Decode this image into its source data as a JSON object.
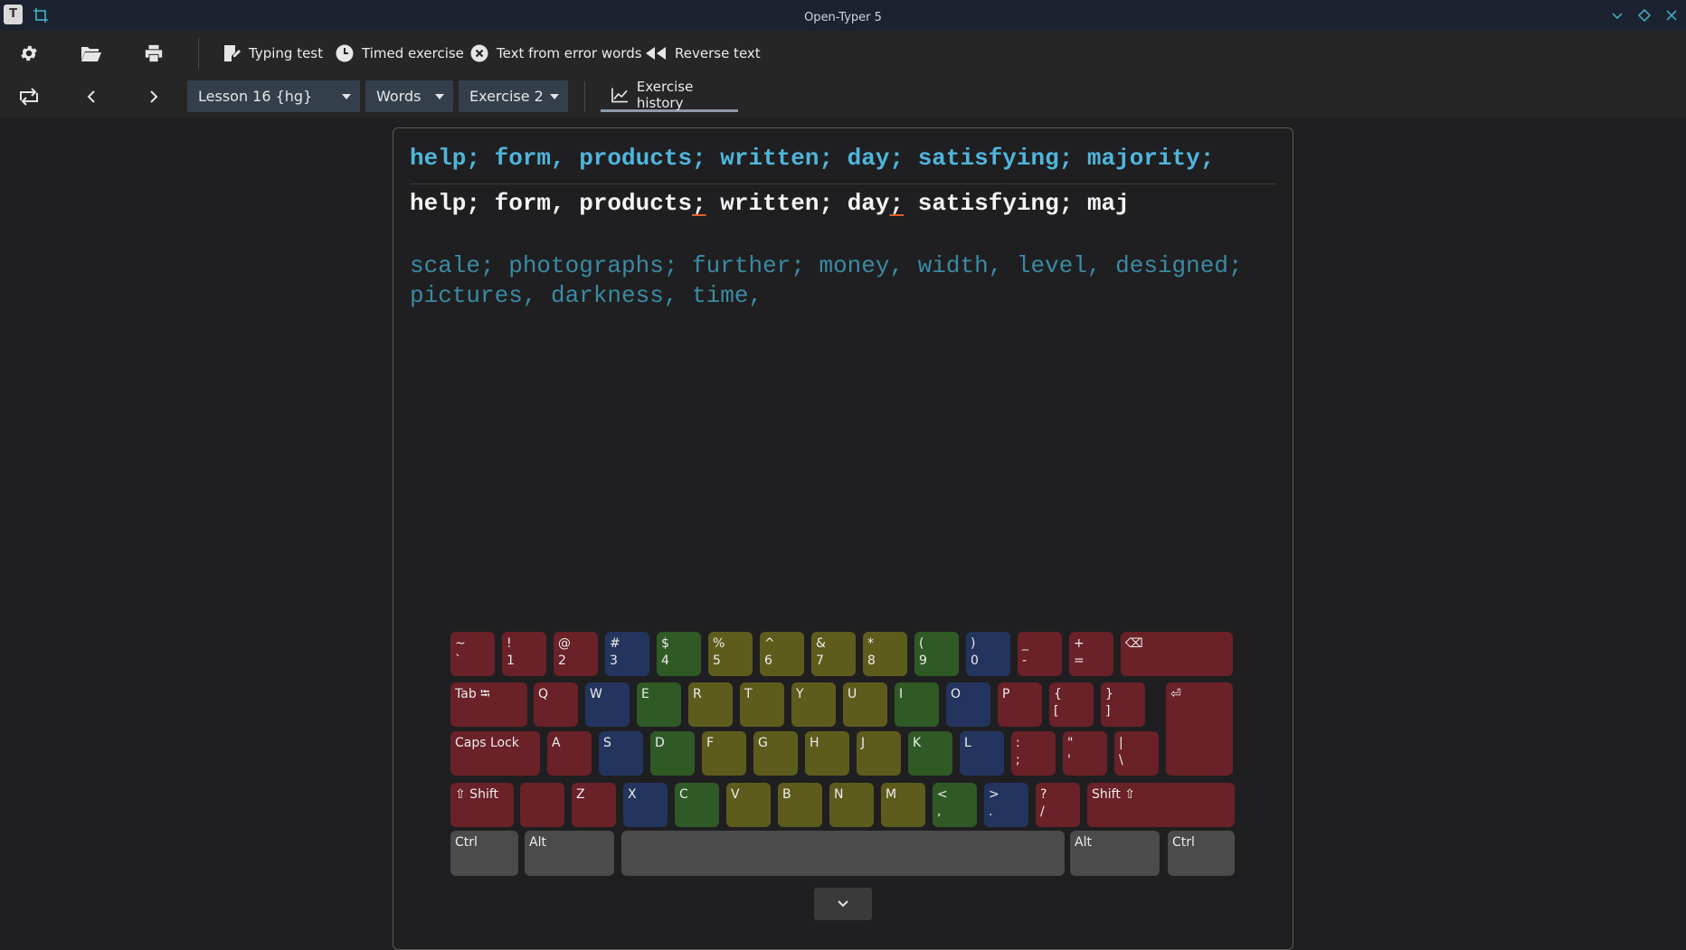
{
  "window": {
    "title": "Open-Typer 5",
    "app_icon_label": "T"
  },
  "toolbar": {
    "typing_test": "Typing test",
    "timed_exercise": "Timed exercise",
    "error_words": "Text from error words",
    "reverse_text": "Reverse text"
  },
  "nav": {
    "lesson": "Lesson 16 {hg}",
    "mode": "Words",
    "exercise": "Exercise 2",
    "history": "Exercise history"
  },
  "exercise": {
    "target_line": "help; form, products; written; day; satisfying; majority;",
    "typed_segments": [
      {
        "text": "help; form, products",
        "error": false
      },
      {
        "text": ";",
        "error": true
      },
      {
        "text": " written; day",
        "error": false
      },
      {
        "text": ";",
        "error": true
      },
      {
        "text": " satisfying; maj",
        "error": false
      }
    ],
    "next_lines": [
      "scale; photographs; further; money, width, level, designed;",
      "pictures, darkness, time,"
    ]
  },
  "keyboard": {
    "rows": [
      [
        {
          "top": "~",
          "bottom": "`",
          "color": "red"
        },
        {
          "top": "!",
          "bottom": "1",
          "color": "red"
        },
        {
          "top": "@",
          "bottom": "2",
          "color": "red"
        },
        {
          "top": "#",
          "bottom": "3",
          "color": "blue"
        },
        {
          "top": "$",
          "bottom": "4",
          "color": "green"
        },
        {
          "top": "%",
          "bottom": "5",
          "color": "olive"
        },
        {
          "top": "^",
          "bottom": "6",
          "color": "olive"
        },
        {
          "top": "&",
          "bottom": "7",
          "color": "olive"
        },
        {
          "top": "*",
          "bottom": "8",
          "color": "olive"
        },
        {
          "top": "(",
          "bottom": "9",
          "color": "green"
        },
        {
          "top": ")",
          "bottom": "0",
          "color": "blue"
        },
        {
          "top": "_",
          "bottom": "-",
          "color": "red"
        },
        {
          "top": "+",
          "bottom": "=",
          "color": "red"
        },
        {
          "top": "⌫",
          "bottom": "",
          "color": "red"
        }
      ],
      [
        {
          "top": "Tab ⭾",
          "bottom": "",
          "color": "red"
        },
        {
          "top": "Q",
          "bottom": "",
          "color": "red"
        },
        {
          "top": "W",
          "bottom": "",
          "color": "blue"
        },
        {
          "top": "E",
          "bottom": "",
          "color": "green"
        },
        {
          "top": "R",
          "bottom": "",
          "color": "olive"
        },
        {
          "top": "T",
          "bottom": "",
          "color": "olive"
        },
        {
          "top": "Y",
          "bottom": "",
          "color": "olive"
        },
        {
          "top": "U",
          "bottom": "",
          "color": "olive"
        },
        {
          "top": "I",
          "bottom": "",
          "color": "green"
        },
        {
          "top": "O",
          "bottom": "",
          "color": "blue"
        },
        {
          "top": "P",
          "bottom": "",
          "color": "red"
        },
        {
          "top": "{",
          "bottom": "[",
          "color": "red"
        },
        {
          "top": "}",
          "bottom": "]",
          "color": "red"
        },
        {
          "top": "⏎",
          "bottom": "",
          "color": "red"
        }
      ],
      [
        {
          "top": "Caps Lock",
          "bottom": "",
          "color": "red"
        },
        {
          "top": "A",
          "bottom": "",
          "color": "red"
        },
        {
          "top": "S",
          "bottom": "",
          "color": "blue"
        },
        {
          "top": "D",
          "bottom": "",
          "color": "green"
        },
        {
          "top": "F",
          "bottom": "",
          "color": "olive"
        },
        {
          "top": "G",
          "bottom": "",
          "color": "olive"
        },
        {
          "top": "H",
          "bottom": "",
          "color": "olive"
        },
        {
          "top": "J",
          "bottom": "",
          "color": "olive"
        },
        {
          "top": "K",
          "bottom": "",
          "color": "green"
        },
        {
          "top": "L",
          "bottom": "",
          "color": "blue"
        },
        {
          "top": ":",
          "bottom": ";",
          "color": "red"
        },
        {
          "top": "\"",
          "bottom": "'",
          "color": "red"
        },
        {
          "top": "|",
          "bottom": "\\",
          "color": "red"
        }
      ],
      [
        {
          "top": "⇧ Shift",
          "bottom": "",
          "color": "red"
        },
        {
          "top": "",
          "bottom": "",
          "color": "red"
        },
        {
          "top": "Z",
          "bottom": "",
          "color": "red"
        },
        {
          "top": "X",
          "bottom": "",
          "color": "blue"
        },
        {
          "top": "C",
          "bottom": "",
          "color": "green"
        },
        {
          "top": "V",
          "bottom": "",
          "color": "olive"
        },
        {
          "top": "B",
          "bottom": "",
          "color": "olive"
        },
        {
          "top": "N",
          "bottom": "",
          "color": "olive"
        },
        {
          "top": "M",
          "bottom": "",
          "color": "olive"
        },
        {
          "top": "<",
          "bottom": ",",
          "color": "green"
        },
        {
          "top": ">",
          "bottom": ".",
          "color": "blue"
        },
        {
          "top": "?",
          "bottom": "/",
          "color": "red"
        },
        {
          "top": "Shift ⇧",
          "bottom": "",
          "color": "red"
        }
      ],
      [
        {
          "top": "Ctrl",
          "bottom": "",
          "color": "gray"
        },
        {
          "top": "Alt",
          "bottom": "",
          "color": "gray"
        },
        {
          "top": "",
          "bottom": "",
          "color": "gray"
        },
        {
          "top": "Alt",
          "bottom": "",
          "color": "gray"
        },
        {
          "top": "Ctrl",
          "bottom": "",
          "color": "gray"
        }
      ]
    ]
  },
  "colors": {
    "target_text": "#4fb6dc",
    "typed_text": "#f4f4f4",
    "upcoming_text": "#3b8aa3",
    "error_underline": "#e0602c"
  }
}
